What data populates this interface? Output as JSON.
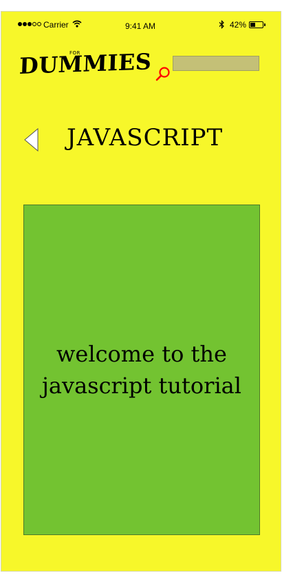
{
  "status_bar": {
    "carrier": "Carrier",
    "time": "9:41 AM",
    "battery_text": "42%",
    "battery_level": 0.42,
    "signal_bars_filled": 3,
    "signal_bars_total": 5
  },
  "header": {
    "logo_for": "FOR",
    "logo_main": "DUMMIES",
    "search_value": "",
    "search_icon": "search-icon"
  },
  "page": {
    "title": "JAVASCRIPT",
    "back_icon": "back-triangle-icon"
  },
  "content": {
    "welcome_text": "welcome to the\njavascript tutorial"
  },
  "colors": {
    "background": "#f7f72a",
    "card": "#73c331",
    "search_field": "#c4c077",
    "search_icon": "#ff0000"
  }
}
